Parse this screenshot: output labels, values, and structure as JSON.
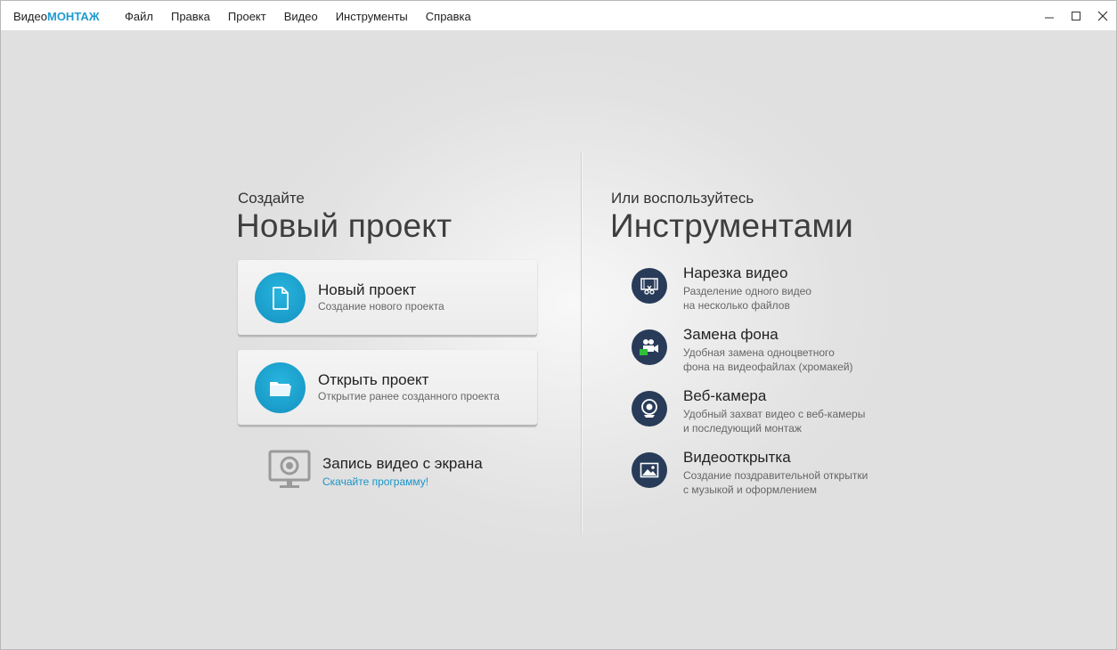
{
  "app": {
    "name_prefix": "Видео",
    "name_brand": "МОНТАЖ",
    "brand_color": "#1e9bd0"
  },
  "menu": [
    "Файл",
    "Правка",
    "Проект",
    "Видео",
    "Инструменты",
    "Справка"
  ],
  "left": {
    "kicker": "Создайте",
    "title": "Новый проект",
    "cards": [
      {
        "title": "Новый проект",
        "subtitle": "Создание нового проекта",
        "icon": "document-icon"
      },
      {
        "title": "Открыть проект",
        "subtitle": "Открытие ранее созданного проекта",
        "icon": "folder-icon"
      }
    ],
    "record": {
      "title": "Запись видео с экрана",
      "link": "Скачайте программу!",
      "icon": "monitor-webcam-icon"
    }
  },
  "right": {
    "kicker": "Или воспользуйтесь",
    "title": "Инструментами",
    "tools": [
      {
        "title": "Нарезка видео",
        "line1": "Разделение одного видео",
        "line2": "на несколько файлов",
        "icon": "scissors-film-icon"
      },
      {
        "title": "Замена фона",
        "line1": "Удобная замена одноцветного",
        "line2": "фона на видеофайлах (хромакей)",
        "icon": "chromakey-camera-icon"
      },
      {
        "title": "Веб-камера",
        "line1": "Удобный захват видео с веб-камеры",
        "line2": "и последующий монтаж",
        "icon": "webcam-icon"
      },
      {
        "title": "Видеооткрытка",
        "line1": "Создание поздравительной открытки",
        "line2": "с музыкой и оформлением",
        "icon": "image-card-icon"
      }
    ]
  },
  "colors": {
    "accent": "#1a9cc9",
    "tool_icon_bg": "#283b58",
    "link": "#1a94c8"
  }
}
